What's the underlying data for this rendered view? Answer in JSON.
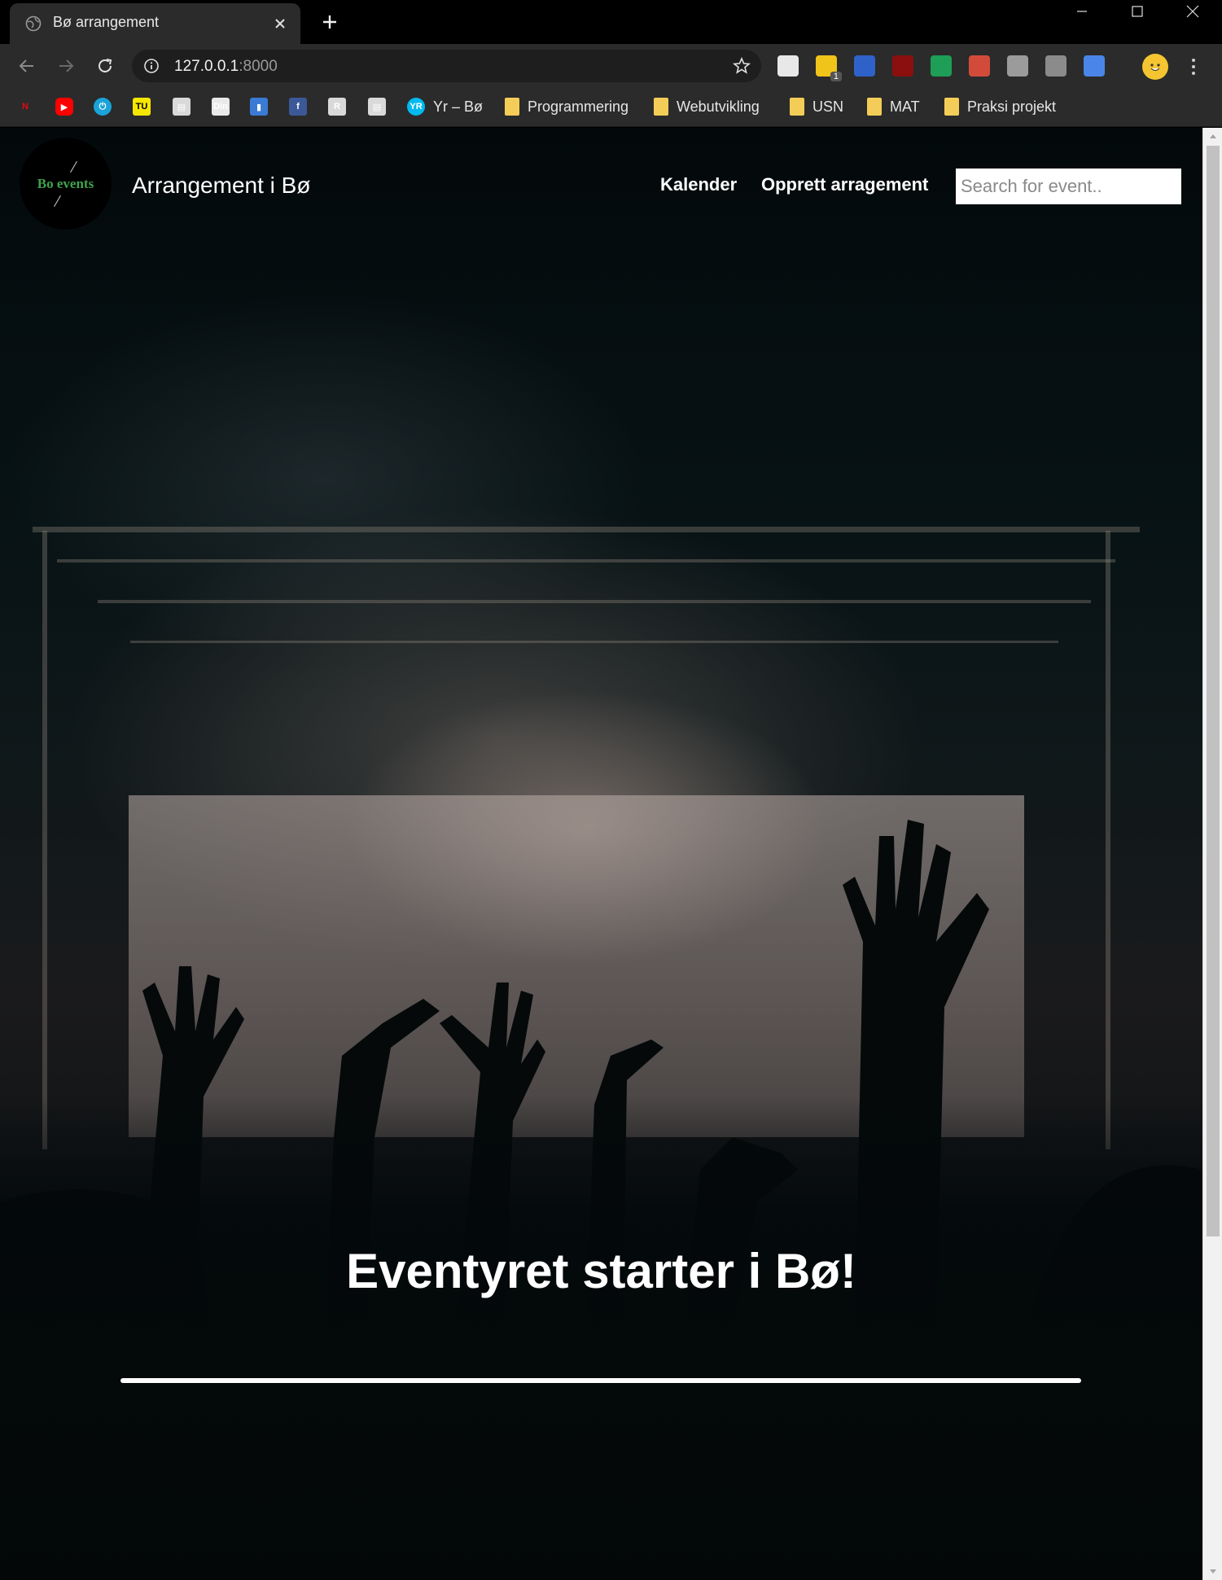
{
  "browser": {
    "tab": {
      "title": "Bø arrangement"
    },
    "address": {
      "host": "127.0.0.1",
      "port": ":8000"
    },
    "extensions": [
      {
        "icon": "reader-icon",
        "color": "#e8e8e8"
      },
      {
        "icon": "notes-extension-icon",
        "color": "#f0c419",
        "badge": "1"
      },
      {
        "icon": "search-extension-icon",
        "color": "#2f62c9"
      },
      {
        "icon": "ublock-icon",
        "color": "#8b0f0f"
      },
      {
        "icon": "sheets-icon",
        "color": "#1e9e56"
      },
      {
        "icon": "cast-icon",
        "color": "#d24b3a"
      },
      {
        "icon": "tampermonkey-icon",
        "color": "#9b9b9b"
      },
      {
        "icon": "download-icon",
        "color": "#8b8b8b"
      },
      {
        "icon": "translate-icon",
        "color": "#4a86e8"
      }
    ],
    "bookmarks": [
      {
        "icon": "netflix-icon",
        "label": "",
        "color": "#e50914",
        "glyph": "N"
      },
      {
        "icon": "youtube-icon",
        "label": "",
        "color": "#ff0000",
        "glyph": "▶"
      },
      {
        "icon": "power-icon",
        "label": "",
        "color": "#1aa3d9",
        "glyph": "⏻"
      },
      {
        "icon": "tu-icon",
        "label": "",
        "color": "#f7e600",
        "glyph": "TU"
      },
      {
        "icon": "monitor-icon",
        "label": "",
        "color": "#d9d9d9",
        "glyph": "▤"
      },
      {
        "icon": "dinside-icon",
        "label": "",
        "color": "#e9e9e9",
        "glyph": "Din"
      },
      {
        "icon": "book-icon",
        "label": "",
        "color": "#3a7bd5",
        "glyph": "▮"
      },
      {
        "icon": "facebook-icon",
        "label": "",
        "color": "#3b5998",
        "glyph": "f"
      },
      {
        "icon": "r-icon",
        "label": "",
        "color": "#d9d9d9",
        "glyph": "R"
      },
      {
        "icon": "monitor2-icon",
        "label": "",
        "color": "#d9d9d9",
        "glyph": "▤"
      },
      {
        "icon": "yr-icon",
        "label": "Yr – Bø",
        "color": "#00b9f1",
        "glyph": "YR"
      },
      {
        "icon": "folder-icon",
        "label": "Programmering",
        "color": "#f3cd57"
      },
      {
        "icon": "folder-icon",
        "label": "Webutvikling",
        "color": "#f3cd57"
      },
      {
        "icon": "folder-icon",
        "label": "USN",
        "color": "#f3cd57"
      },
      {
        "icon": "folder-icon",
        "label": "MAT",
        "color": "#f3cd57"
      },
      {
        "icon": "folder-icon",
        "label": "Praksi projekt",
        "color": "#f3cd57"
      }
    ]
  },
  "site": {
    "logo_text": "Bo events",
    "title": "Arrangement i Bø",
    "nav": [
      {
        "label": "Kalender"
      },
      {
        "label": "Opprett arragement"
      }
    ],
    "search": {
      "placeholder": "Search for event.."
    },
    "hero_heading": "Eventyret starter i Bø!"
  },
  "colors": {
    "logo_green": "#3fa34d",
    "chrome_dark": "#2b2b2b",
    "folder_yellow": "#f3cd57"
  }
}
